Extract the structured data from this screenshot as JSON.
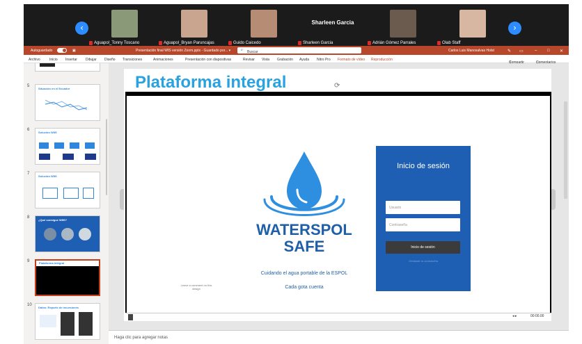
{
  "participants": {
    "tiles": [
      {
        "name": "Aguapol_Tonny Toscano",
        "face_color": "#8a9a78"
      },
      {
        "name": "Aguapol_Bryan Paruncajas",
        "face_color": "#c9a48e"
      },
      {
        "name": "Guido Caicedo",
        "face_color": "#b68c74"
      },
      {
        "name": "Sharleen Garcia",
        "big_name": "Sharleen Garcia"
      },
      {
        "name": "Adrián Gómez Parrales",
        "face_color": "#6b5a4e"
      },
      {
        "name": "Olab Staff",
        "face_color": "#d7b6a2"
      }
    ],
    "prev_icon": "chevron-left-icon",
    "next_icon": "chevron-right-icon"
  },
  "titlebar": {
    "autosave_label": "Autoguardado",
    "document_title": "Presentación final WIS versión Zoom.pptx - Guardado por... ▾",
    "search_placeholder": "Buscar",
    "user_name": "Carlos Luis Manosalvas Holst"
  },
  "ribbon": {
    "tabs": [
      "Archivo",
      "Inicio",
      "Insertar",
      "Dibujar",
      "Diseño",
      "Transiciones",
      "Animaciones",
      "Presentación con diapositivas",
      "Revisar",
      "Vista",
      "Grabación",
      "Ayuda",
      "Nitro Pro",
      "Formato de vídeo",
      "Reproducción"
    ],
    "share_label": "Compartir",
    "comments_label": "Comentarios"
  },
  "thumbnails": [
    {
      "number": "5",
      "title": "Situación en el Ecuador"
    },
    {
      "number": "6",
      "title": "Solución WIIS"
    },
    {
      "number": "7",
      "title": "Solución WIIS"
    },
    {
      "number": "8",
      "title": "¿Qué consigue WIIS?"
    },
    {
      "number": "9",
      "title": "Plataforma integral"
    },
    {
      "number": "10",
      "title": "Datos: Reporte de incursiones"
    }
  ],
  "slide": {
    "title": "Plataforma integral",
    "brand_line1": "WATERSPOL",
    "brand_line2": "SAFE",
    "tagline1": "Cuidando el agua portable de la ESPOL",
    "tagline2": "Cada gota cuenta",
    "login": {
      "title": "Inicio de sesión",
      "user_placeholder": "Usuario",
      "password_placeholder": "Contraseña",
      "button_label": "Inicio de sesión",
      "forgot_label": "Olvidaste tu contraseña"
    },
    "comment_hint": "Leave a comment on this design",
    "video_time": "00:00.00",
    "water_color": "#2e8ee0"
  },
  "notes": {
    "placeholder": "Haga clic para agregar notas"
  }
}
